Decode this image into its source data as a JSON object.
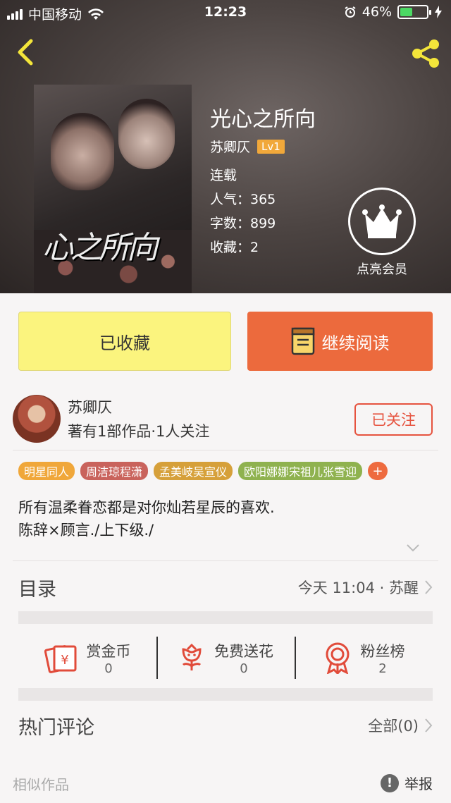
{
  "status_bar": {
    "carrier": "中国移动",
    "time": "12:23",
    "battery": "46%",
    "battery_level": 0.46
  },
  "book": {
    "title": "光心之所向",
    "author": "苏卿仄",
    "level": "Lv1",
    "status": "连载",
    "popularity": "人气：365",
    "words": "字数：899",
    "favorites": "收藏：2",
    "cover_title": "心之所向"
  },
  "vip": {
    "label": "点亮会员"
  },
  "buttons": {
    "collected": "已收藏",
    "continue_reading": "继续阅读"
  },
  "author_card": {
    "name": "苏卿仄",
    "stats": "著有1部作品·1人关注",
    "follow_label": "已关注"
  },
  "tags": [
    {
      "label": "明星同人",
      "color": "#f0a73a"
    },
    {
      "label": "周洁琼程潇",
      "color": "#c9635c"
    },
    {
      "label": "孟美岐吴宣仪",
      "color": "#d6a03a"
    },
    {
      "label": "欧阳娜娜宋祖儿张雪迎",
      "color": "#8fb24f"
    }
  ],
  "tag_more": "+",
  "intro": {
    "line1": "所有温柔眷恋都是对你灿若星辰的喜欢.",
    "line2": "陈辞×顾言./上下级./"
  },
  "catalog": {
    "label": "目录",
    "latest": "今天 11:04 · 苏醒"
  },
  "actions": [
    {
      "label": "赏金币",
      "count": "0",
      "icon": "red-envelope-icon"
    },
    {
      "label": "免费送花",
      "count": "0",
      "icon": "flower-icon"
    },
    {
      "label": "粉丝榜",
      "count": "2",
      "icon": "medal-icon"
    }
  ],
  "comments": {
    "label": "热门评论",
    "all": "全部(0)"
  },
  "footer": {
    "similar": "相似作品",
    "report": "举报"
  },
  "colors": {
    "accent_orange": "#ec6a3d",
    "collected_yellow": "#fbf47e",
    "follow_red": "#e6533f",
    "icon_yellow": "#f3e53a"
  }
}
